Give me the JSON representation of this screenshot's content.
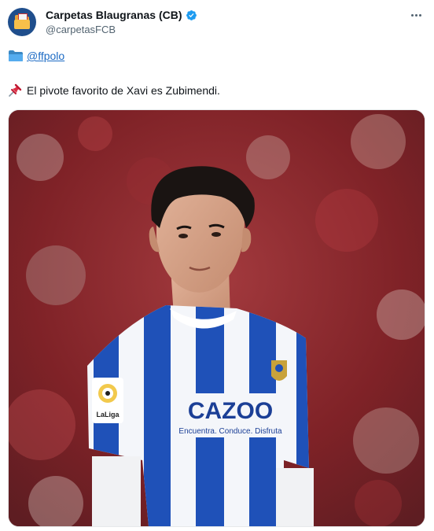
{
  "author": {
    "display_name": "Carpetas Blaugranas (CB)",
    "handle": "@carpetasFCB",
    "avatar_icon": "folder-avatar-icon",
    "verified": true,
    "verified_color": "#1d9bf0"
  },
  "tweet": {
    "mention": "@ffpolo",
    "text": "El pivote favorito de Xavi es Zubimendi.",
    "mention_icon": "folder-icon",
    "text_icon": "pushpin-icon",
    "link_color": "#1d6bc4"
  },
  "media": {
    "sponsor_main": "CAZOO",
    "sponsor_sub": "Encuentra. Conduce. Disfruta",
    "league_label": "LaLiga",
    "kit_colors": {
      "blue": "#1f51b8",
      "white": "#f4f6fa"
    }
  }
}
